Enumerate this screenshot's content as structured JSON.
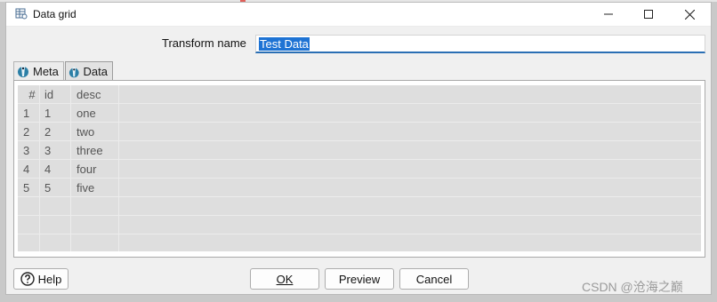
{
  "window": {
    "title": "Data grid"
  },
  "form": {
    "transform_name_label": "Transform name",
    "transform_name_value": "Test Data"
  },
  "tabs": [
    {
      "label": "Meta"
    },
    {
      "label": "Data"
    }
  ],
  "grid": {
    "columns": [
      "#",
      "id",
      "desc"
    ],
    "rows": [
      [
        "1",
        "1",
        "one"
      ],
      [
        "2",
        "2",
        "two"
      ],
      [
        "3",
        "3",
        "three"
      ],
      [
        "4",
        "4",
        "four"
      ],
      [
        "5",
        "5",
        "five"
      ]
    ]
  },
  "buttons": {
    "help": "Help",
    "ok": "OK",
    "preview": "Preview",
    "cancel": "Cancel"
  },
  "watermark": "CSDN @沧海之巅",
  "colors": {
    "accent": "#1e73d4",
    "grid_bg": "#dedede",
    "window_bg": "#f0f0f0"
  }
}
